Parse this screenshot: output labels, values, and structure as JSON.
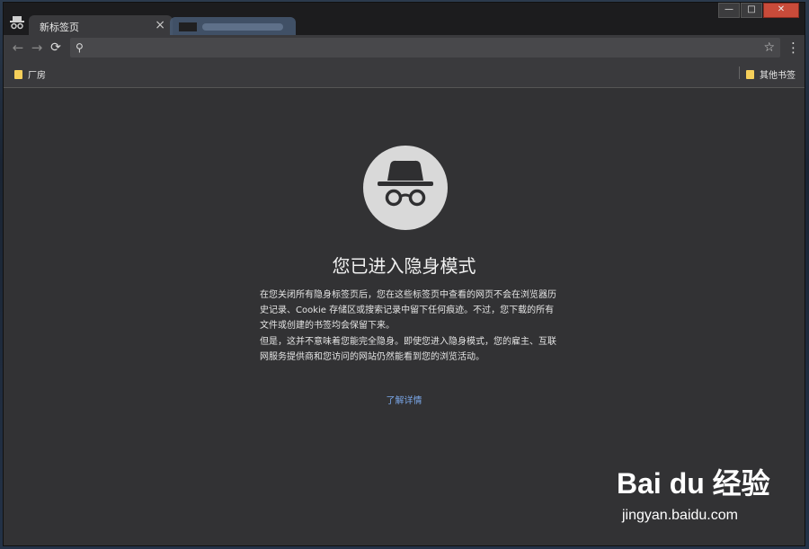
{
  "window": {
    "badge_icon": "incognito-badge-icon",
    "controls": {
      "minimize": "—",
      "maximize": "□",
      "close": "✕"
    }
  },
  "tabs": [
    {
      "label": "新标签页",
      "active": true,
      "close": "×"
    },
    {
      "label": "",
      "active": false
    }
  ],
  "toolbar": {
    "back_icon": "back-arrow-icon",
    "forward_icon": "forward-arrow-icon",
    "reload_icon": "reload-icon",
    "search_icon": "search-icon",
    "omnibox_value": "",
    "star_icon": "star-icon",
    "menu_icon": "kebab-menu-icon"
  },
  "bookmarks": {
    "left": [
      {
        "label": "厂房",
        "icon": "folder-icon"
      }
    ],
    "right": [
      {
        "label": "其他书签",
        "icon": "folder-icon"
      }
    ]
  },
  "incognito": {
    "icon": "incognito-spy-icon",
    "title": "您已进入隐身模式",
    "paragraph1": "在您关闭所有隐身标签页后，您在这些标签页中查看的网页不会在浏览器历史记录、Cookie 存储区或搜索记录中留下任何痕迹。不过，您下载的所有文件或创建的书签均会保留下来。",
    "paragraph2": "但是，这并不意味着您能完全隐身。即使您进入隐身模式，您的雇主、互联网服务提供商和您访问的网站仍然能看到您的浏览活动。",
    "learn_more": "了解详情"
  },
  "watermark": {
    "brand": "Bai du 经验",
    "domain": "jingyan.baidu.com"
  },
  "colors": {
    "content_bg": "#323234",
    "toolbar_bg": "#3a3a3d",
    "link": "#7aa7e8",
    "folder": "#f5cf5a"
  }
}
